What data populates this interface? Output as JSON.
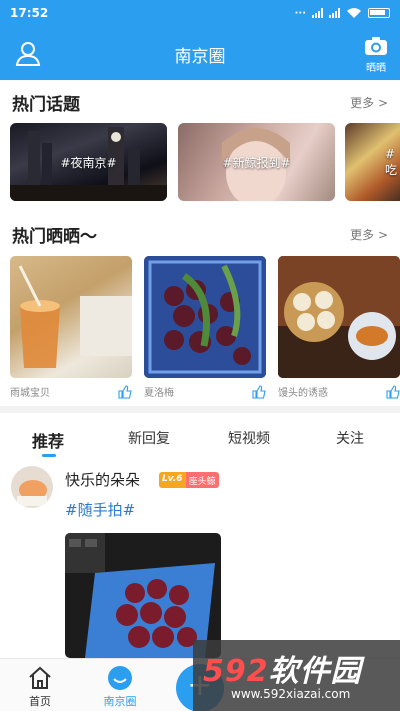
{
  "status_bar": {
    "time": "17:52"
  },
  "header": {
    "title": "南京圈",
    "camera_label": "晒晒"
  },
  "hot_topics": {
    "title": "热门话题",
    "more": "更多",
    "items": [
      {
        "label": "#夜南京#"
      },
      {
        "label": "#新鲸报到#"
      },
      {
        "label": "#吃"
      }
    ]
  },
  "hot_shows": {
    "title": "热门晒晒～",
    "more": "更多",
    "items": [
      {
        "caption": "雨城宝贝"
      },
      {
        "caption": "夏洛梅"
      },
      {
        "caption": "馒头的诱惑"
      }
    ]
  },
  "feed_tabs": [
    "推荐",
    "新回复",
    "短视频",
    "关注"
  ],
  "post": {
    "author": "快乐的朵朵",
    "level": "Lv.6",
    "rank": "座头鲸",
    "tag": "#随手拍#"
  },
  "bottom_nav": {
    "home": "首页",
    "circle": "南京圈",
    "fab": "+"
  },
  "watermark": {
    "brand_num": "592",
    "brand_text": "软件园",
    "url": "www.592xiazai.com"
  },
  "colors": {
    "primary": "#2b9ef0",
    "tag": "#2b7bd1",
    "badge_level": "#f5a623",
    "badge_rank": "#ff6f6f"
  }
}
